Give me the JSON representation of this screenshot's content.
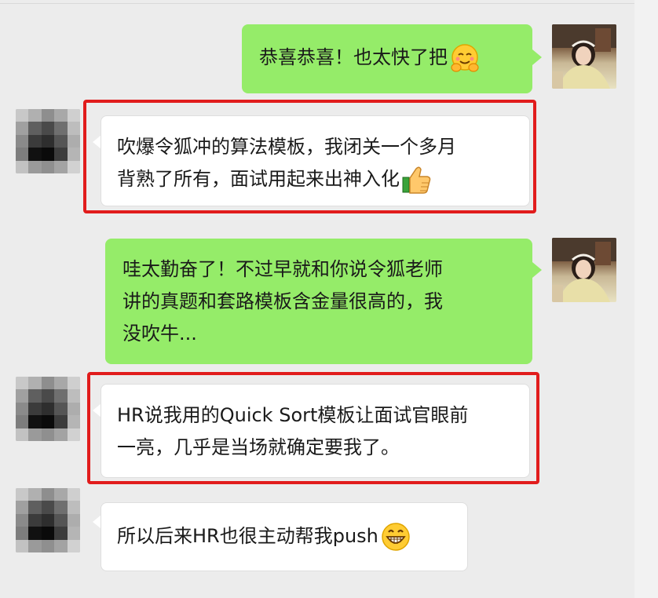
{
  "chat": {
    "messages": [
      {
        "sender": "self",
        "text": "恭喜恭喜！也太快了把",
        "emoji": "hugging-face-emoji"
      },
      {
        "sender": "other",
        "lines": [
          "吹爆令狐冲的算法模板，我闭关一个多月",
          "背熟了所有，面试用起来出神入化"
        ],
        "emoji": "thumbs-up-emoji",
        "highlighted": true
      },
      {
        "sender": "self",
        "lines": [
          "哇太勤奋了！不过早就和你说令狐老师",
          "讲的真题和套路模板含金量很高的，我",
          "没吹牛..."
        ]
      },
      {
        "sender": "other",
        "lines": [
          "HR说我用的Quick Sort模板让面试官眼前",
          "一亮，几乎是当场就确定要我了。"
        ],
        "highlighted": true
      },
      {
        "sender": "other",
        "text": "所以后来HR也很主动帮我push",
        "emoji": "grinning-face-emoji"
      }
    ]
  },
  "colors": {
    "outgoing_bubble": "#95ec69",
    "incoming_bubble": "#ffffff",
    "highlight": "#e11c1c",
    "background": "#ececec"
  }
}
